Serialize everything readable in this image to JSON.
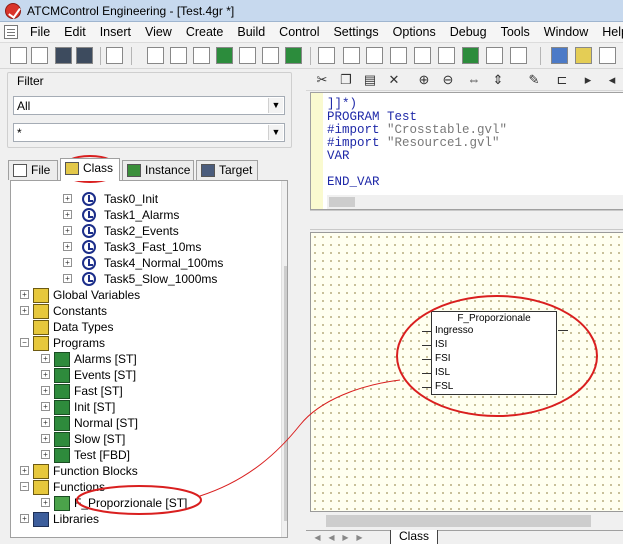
{
  "window": {
    "title": "ATCMControl Engineering - [Test.4gr *]"
  },
  "menu": [
    "File",
    "Edit",
    "Insert",
    "View",
    "Create",
    "Build",
    "Control",
    "Settings",
    "Options",
    "Debug",
    "Tools",
    "Window",
    "Help"
  ],
  "filter": {
    "label": "Filter",
    "combo1": "All",
    "combo2": "*"
  },
  "tabs": [
    "File",
    "Class",
    "Instance",
    "Target"
  ],
  "tree": [
    {
      "label": "Task0_Init",
      "icon": "clock-icon"
    },
    {
      "label": "Task1_Alarms",
      "icon": "clock-icon"
    },
    {
      "label": "Task2_Events",
      "icon": "clock-icon"
    },
    {
      "label": "Task3_Fast_10ms",
      "icon": "clock-icon"
    },
    {
      "label": "Task4_Normal_100ms",
      "icon": "clock-icon"
    },
    {
      "label": "Task5_Slow_1000ms",
      "icon": "clock-icon"
    },
    {
      "label": "Global Variables",
      "icon": "folder-icon"
    },
    {
      "label": "Constants",
      "icon": "constants-icon"
    },
    {
      "label": "Data Types",
      "icon": "folder-icon"
    },
    {
      "label": "Programs",
      "icon": "folder-icon"
    },
    {
      "label": "Alarms [ST]",
      "icon": "program-icon"
    },
    {
      "label": "Events [ST]",
      "icon": "program-icon"
    },
    {
      "label": "Fast [ST]",
      "icon": "program-icon"
    },
    {
      "label": "Init [ST]",
      "icon": "program-icon"
    },
    {
      "label": "Normal [ST]",
      "icon": "program-icon"
    },
    {
      "label": "Slow [ST]",
      "icon": "program-icon"
    },
    {
      "label": "Test [FBD]",
      "icon": "program-icon"
    },
    {
      "label": "Function Blocks",
      "icon": "folder-icon"
    },
    {
      "label": "Functions",
      "icon": "folder-icon"
    },
    {
      "label": "F_Proporzionale [ST]",
      "icon": "function-icon"
    },
    {
      "label": "Libraries",
      "icon": "books-icon"
    }
  ],
  "code": {
    "lines": [
      "]]*)",
      "PROGRAM Test",
      "#import",
      "#import",
      "VAR",
      "",
      "END_VAR"
    ],
    "import1": "\"Crosstable.gvl\"",
    "import2": "\"Resource1.gvl\""
  },
  "block": {
    "title": "F_Proporzionale",
    "pins": [
      "Ingresso",
      "ISI",
      "FSI",
      "ISL",
      "FSL"
    ]
  },
  "bottom_tab": "Class",
  "colors": {
    "highlight": "#d91f1f",
    "code": "#1f29a8",
    "title_bar": "#c7d9ee"
  }
}
